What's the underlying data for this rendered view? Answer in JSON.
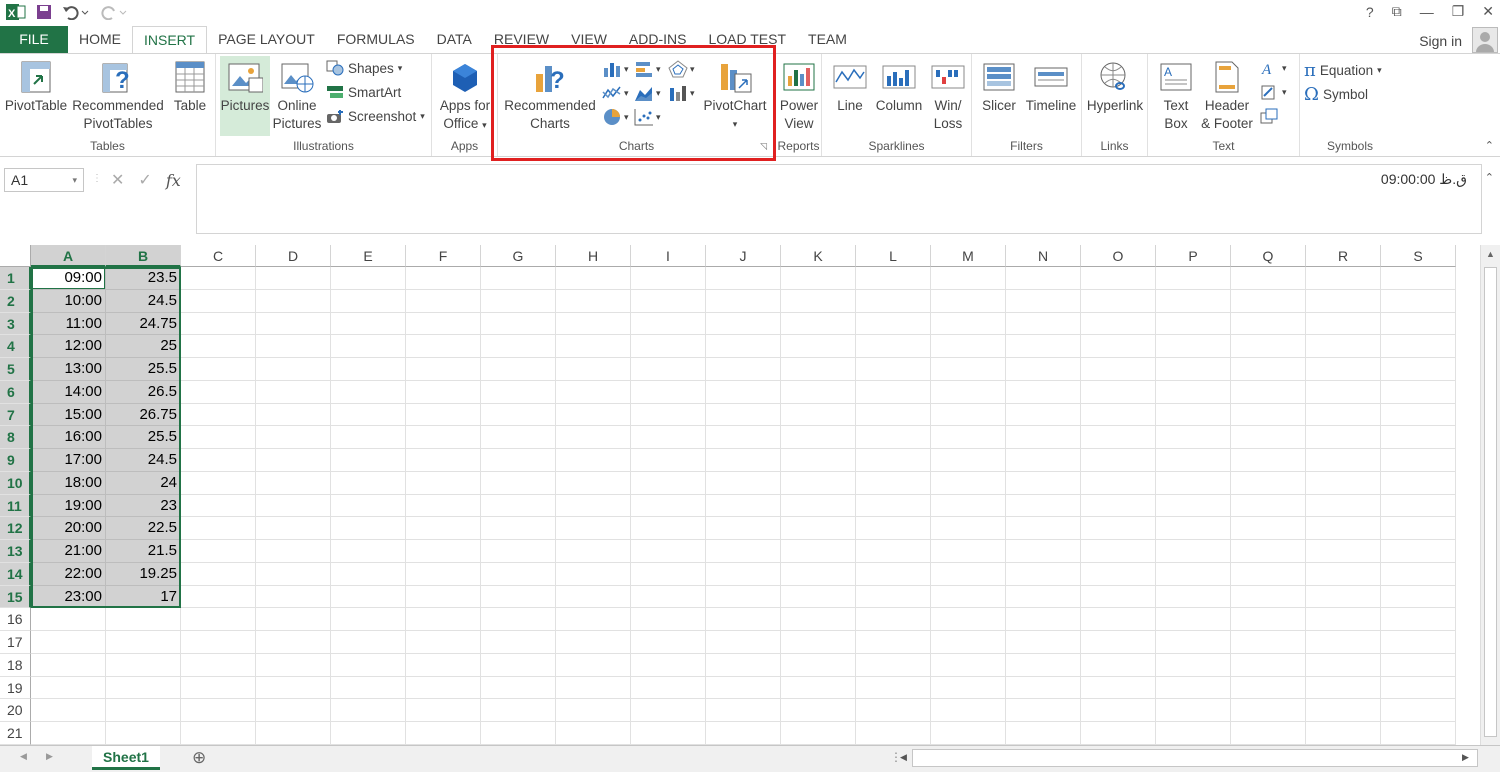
{
  "window": {
    "minimize": "—",
    "restore": "❐",
    "close": "✕",
    "help": "?"
  },
  "tabs": [
    "FILE",
    "HOME",
    "INSERT",
    "PAGE LAYOUT",
    "FORMULAS",
    "DATA",
    "REVIEW",
    "VIEW",
    "ADD-INS",
    "LOAD TEST",
    "TEAM"
  ],
  "active_tab": "INSERT",
  "signin": "Sign in",
  "ribbon": {
    "tables": {
      "label": "Tables",
      "pivottable": "PivotTable",
      "recommended_1": "Recommended",
      "recommended_2": "PivotTables",
      "table": "Table"
    },
    "illustrations": {
      "label": "Illustrations",
      "pictures": "Pictures",
      "online_1": "Online",
      "online_2": "Pictures",
      "shapes": "Shapes",
      "smartart": "SmartArt",
      "screenshot": "Screenshot"
    },
    "apps": {
      "label": "Apps",
      "apps_1": "Apps for",
      "apps_2": "Office"
    },
    "charts": {
      "label": "Charts",
      "recommended_1": "Recommended",
      "recommended_2": "Charts",
      "pivotchart": "PivotChart"
    },
    "reports": {
      "label": "Reports",
      "power_1": "Power",
      "power_2": "View"
    },
    "sparklines": {
      "label": "Sparklines",
      "line": "Line",
      "column": "Column",
      "winloss_1": "Win/",
      "winloss_2": "Loss"
    },
    "filters": {
      "label": "Filters",
      "slicer": "Slicer",
      "timeline": "Timeline"
    },
    "links": {
      "label": "Links",
      "hyperlink": "Hyperlink"
    },
    "text": {
      "label": "Text",
      "textbox_1": "Text",
      "textbox_2": "Box",
      "header_1": "Header",
      "header_2": "& Footer"
    },
    "symbols": {
      "label": "Symbols",
      "equation": "Equation",
      "symbol": "Symbol"
    }
  },
  "formula_bar": {
    "namebox": "A1",
    "value": "09:00:00 ق.ظ"
  },
  "columns": [
    "A",
    "B",
    "C",
    "D",
    "E",
    "F",
    "G",
    "H",
    "I",
    "J",
    "K",
    "L",
    "M",
    "N",
    "O",
    "P",
    "Q",
    "R",
    "S"
  ],
  "rows": [
    {
      "n": "1",
      "a": "09:00",
      "b": "23.5"
    },
    {
      "n": "2",
      "a": "10:00",
      "b": "24.5"
    },
    {
      "n": "3",
      "a": "11:00",
      "b": "24.75"
    },
    {
      "n": "4",
      "a": "12:00",
      "b": "25"
    },
    {
      "n": "5",
      "a": "13:00",
      "b": "25.5"
    },
    {
      "n": "6",
      "a": "14:00",
      "b": "26.5"
    },
    {
      "n": "7",
      "a": "15:00",
      "b": "26.75"
    },
    {
      "n": "8",
      "a": "16:00",
      "b": "25.5"
    },
    {
      "n": "9",
      "a": "17:00",
      "b": "24.5"
    },
    {
      "n": "10",
      "a": "18:00",
      "b": "24"
    },
    {
      "n": "11",
      "a": "19:00",
      "b": "23"
    },
    {
      "n": "12",
      "a": "20:00",
      "b": "22.5"
    },
    {
      "n": "13",
      "a": "21:00",
      "b": "21.5"
    },
    {
      "n": "14",
      "a": "22:00",
      "b": "19.25"
    },
    {
      "n": "15",
      "a": "23:00",
      "b": "17"
    },
    {
      "n": "16",
      "a": "",
      "b": ""
    },
    {
      "n": "17",
      "a": "",
      "b": ""
    },
    {
      "n": "18",
      "a": "",
      "b": ""
    },
    {
      "n": "19",
      "a": "",
      "b": ""
    },
    {
      "n": "20",
      "a": "",
      "b": ""
    },
    {
      "n": "21",
      "a": "",
      "b": ""
    }
  ],
  "sheet_tab": "Sheet1",
  "add_sheet": "⊕"
}
